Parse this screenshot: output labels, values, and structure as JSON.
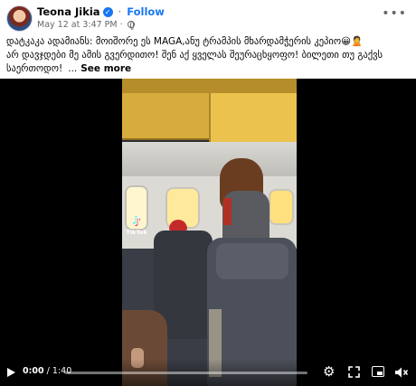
{
  "post": {
    "author": "Teona Jikia",
    "separator": "·",
    "follow_label": "Follow",
    "date": "May 12 at 3:47 PM",
    "date_separator": "·",
    "more_icon": "more-options-icon",
    "verified_icon": "verified-badge-icon",
    "audience_icon": "globe-icon"
  },
  "caption": {
    "line1": "დატკაკა ადამიანს: მოიშორე ეს MAGA,ანუ ტრამპის მხარდამჭერის კეპიო😀🙎",
    "line2": " არ დავჯდები მე ამის გვერდითო! შენ აქ ყველას შეურაცხყოფო! ბილეთი თუ გაქვს",
    "line3": "საერთოდო!",
    "ellipsis": "...",
    "see_more": "See more"
  },
  "video": {
    "watermark": "TikTok",
    "current_time": "0:00",
    "time_separator": "/",
    "duration": "1:40",
    "progress_fraction": 0.0,
    "icons": [
      "play-icon",
      "gear-icon",
      "expand-icon",
      "picture-in-picture-icon",
      "mute-icon"
    ]
  },
  "colors": {
    "accent": "#1877f2",
    "text_secondary": "#65676b",
    "video_background": "#000000"
  }
}
